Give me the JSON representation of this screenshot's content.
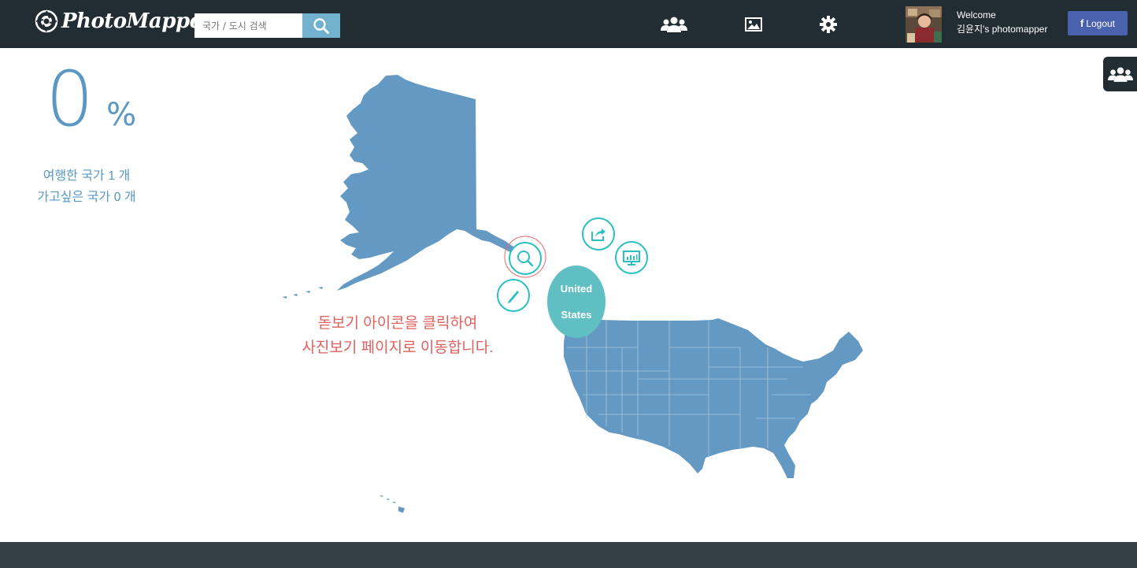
{
  "brand": {
    "name": "PhotoMapper"
  },
  "search": {
    "placeholder": "국가 / 도시 검색"
  },
  "nav": {
    "icons": [
      "friends-icon",
      "photo-icon",
      "gear-icon"
    ]
  },
  "user": {
    "welcome": "Welcome",
    "name": "김윤지's photomapper"
  },
  "logout": {
    "icon": "f",
    "label": "Logout"
  },
  "stats": {
    "percent": "0",
    "percent_sign": "%",
    "visited": "여행한 국가 1 개",
    "wishlist": "가고싶은 국가 0 개"
  },
  "tooltip": {
    "line1": "돋보기 아이콘을 클릭하여",
    "line2": "사진보기 페이지로 이동합니다."
  },
  "country": {
    "line1": "United",
    "line2": "States"
  },
  "colors": {
    "navbar": "#222d33",
    "accent": "#73b2cf",
    "map": "#6399c3",
    "teal": "#2bbfc2",
    "tooltip": "#e0605e",
    "facebook": "#4a61ad"
  }
}
